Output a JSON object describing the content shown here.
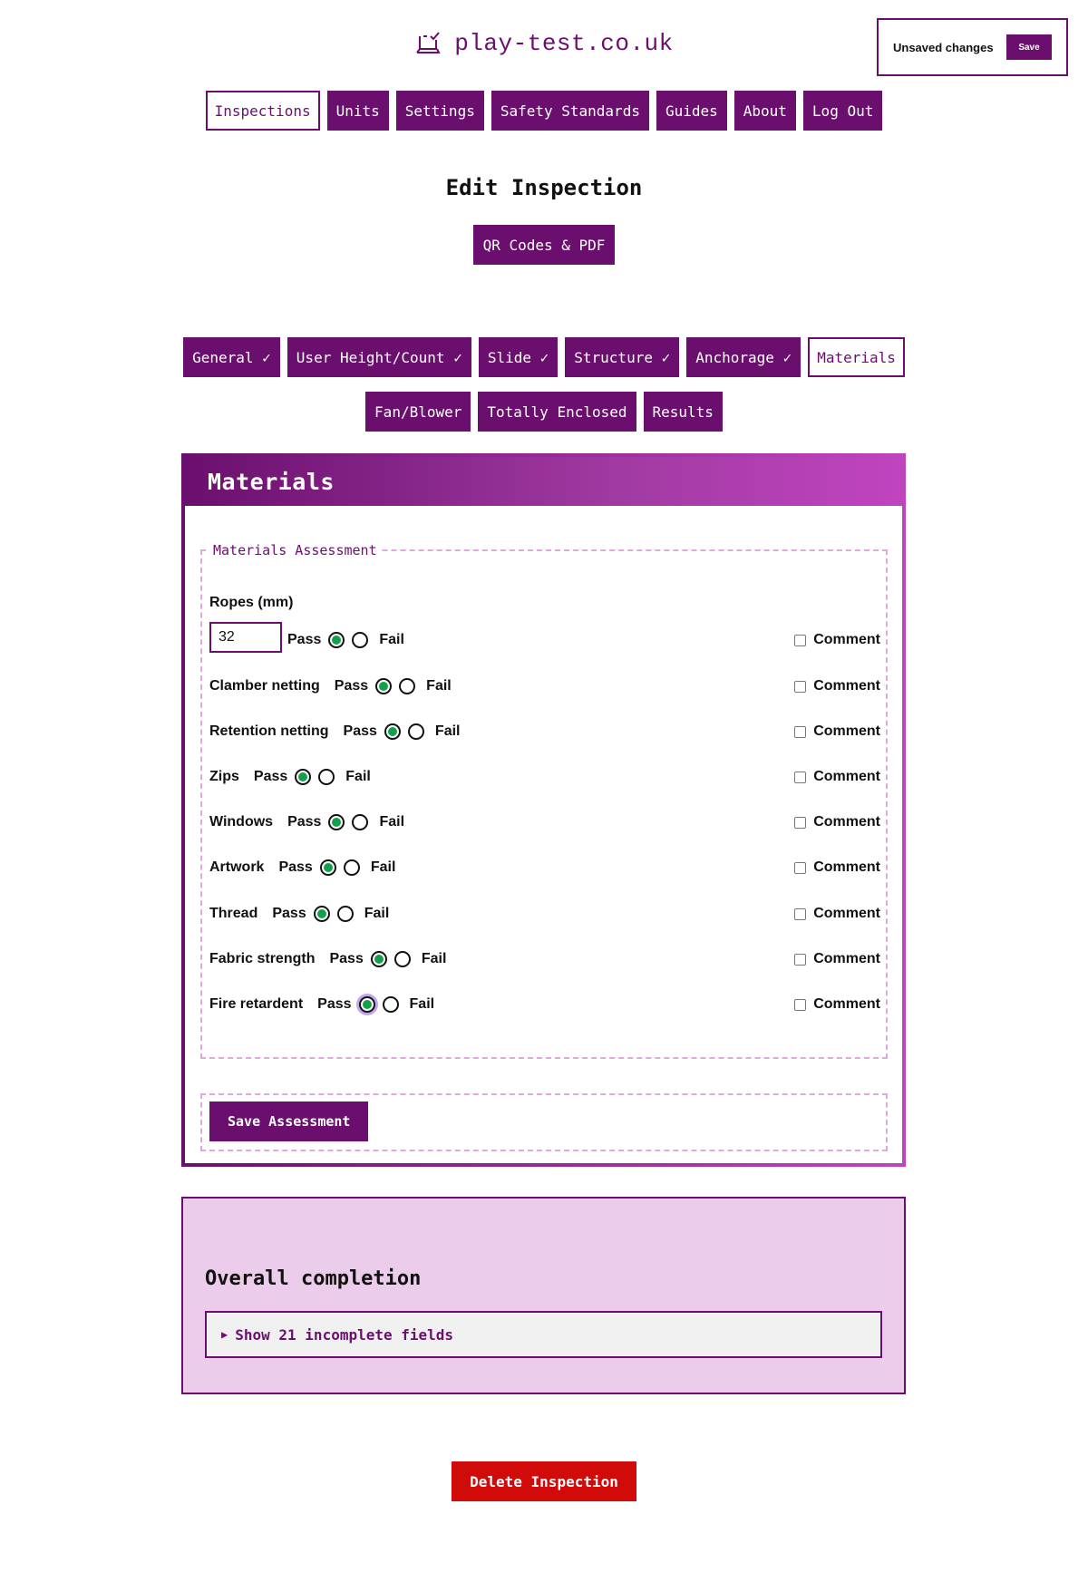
{
  "header": {
    "site_name": "play-test.co.uk",
    "unsaved_text": "Unsaved changes",
    "unsaved_save": "Save"
  },
  "nav": [
    "Inspections",
    "Units",
    "Settings",
    "Safety Standards",
    "Guides",
    "About",
    "Log Out"
  ],
  "page": {
    "title": "Edit Inspection",
    "qr_button": "QR Codes & PDF"
  },
  "tabs_row1": [
    "General ✓",
    "User Height/Count ✓",
    "Slide ✓",
    "Structure ✓",
    "Anchorage ✓",
    "Materials"
  ],
  "tabs_row2": [
    "Fan/Blower",
    "Totally Enclosed",
    "Results"
  ],
  "materials": {
    "title": "Materials",
    "legend": "Materials Assessment",
    "ropes_label": "Ropes (mm)",
    "ropes_value": "32",
    "pass_label": "Pass",
    "fail_label": "Fail",
    "comment_label": "Comment",
    "rows": [
      {
        "label": "",
        "selected": "pass"
      },
      {
        "label": "Clamber netting",
        "selected": "pass"
      },
      {
        "label": "Retention netting",
        "selected": "pass"
      },
      {
        "label": "Zips",
        "selected": "pass"
      },
      {
        "label": "Windows",
        "selected": "pass"
      },
      {
        "label": "Artwork",
        "selected": "pass"
      },
      {
        "label": "Thread",
        "selected": "pass"
      },
      {
        "label": "Fabric strength",
        "selected": "pass"
      },
      {
        "label": "Fire retardent",
        "selected": "pass"
      }
    ],
    "save_button": "Save Assessment"
  },
  "completion": {
    "title": "Overall completion",
    "summary": "Show 21 incomplete fields"
  },
  "delete_button": "Delete Inspection",
  "colors": {
    "brand": "#6b0f6e",
    "accent": "#c044bf",
    "pass_dot": "#12a14a",
    "danger": "#d10a0a"
  }
}
